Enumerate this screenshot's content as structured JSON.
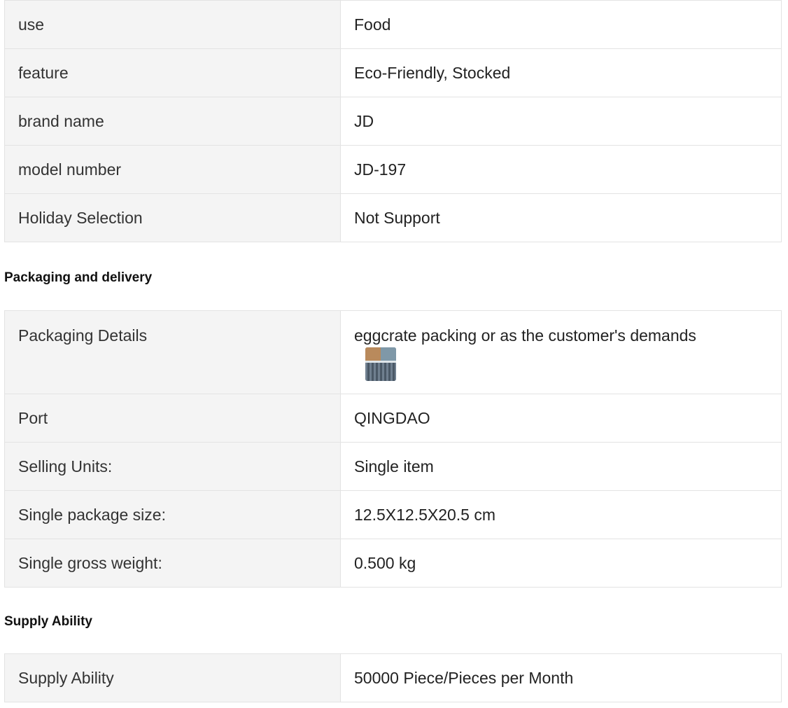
{
  "attributes": [
    {
      "key": "use",
      "value": "Food"
    },
    {
      "key": "feature",
      "value": "Eco-Friendly, Stocked"
    },
    {
      "key": "brand name",
      "value": "JD"
    },
    {
      "key": "model number",
      "value": "JD-197"
    },
    {
      "key": "Holiday Selection",
      "value": "Not Support"
    }
  ],
  "packaging": {
    "title": "Packaging and delivery",
    "rows": [
      {
        "key": "Packaging Details",
        "value": "eggcrate packing or as the customer's demands"
      },
      {
        "key": "Port",
        "value": "QINGDAO"
      },
      {
        "key": "Selling Units:",
        "value": "Single item"
      },
      {
        "key": "Single package size:",
        "value": "12.5X12.5X20.5 cm"
      },
      {
        "key": "Single gross weight:",
        "value": "0.500 kg"
      }
    ],
    "thumbnail_icon": "packaging-photo-icon"
  },
  "supply": {
    "title": "Supply Ability",
    "rows": [
      {
        "key": "Supply Ability",
        "value": "50000 Piece/Pieces per Month"
      }
    ]
  }
}
